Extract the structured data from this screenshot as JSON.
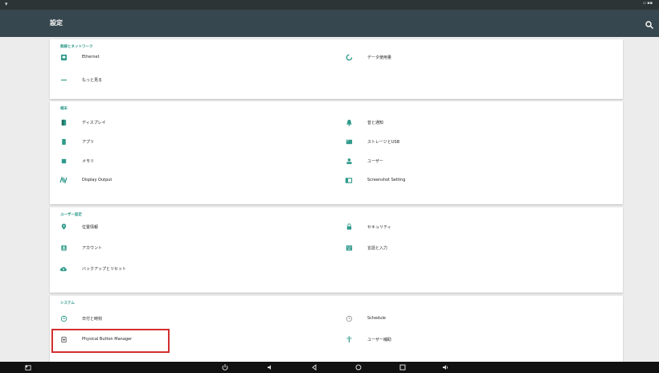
{
  "status": {
    "left": "▾",
    "right": "▫ ▪▪"
  },
  "appbar": {
    "title": "設定",
    "search_icon": "search-icon"
  },
  "sections": [
    {
      "title": "無線とネットワーク",
      "items": [
        {
          "label": "Ethernet",
          "icon": "ethernet-icon",
          "col": 0
        },
        {
          "label": "データ使用量",
          "icon": "data-usage-icon",
          "col": 1
        },
        {
          "label": "もっと見る",
          "icon": "more-icon",
          "col": 0
        }
      ]
    },
    {
      "title": "端末",
      "items": [
        {
          "label": "ディスプレイ",
          "icon": "display-icon",
          "col": 0
        },
        {
          "label": "音と通知",
          "icon": "sound-icon",
          "col": 1
        },
        {
          "label": "アプリ",
          "icon": "apps-icon",
          "col": 0
        },
        {
          "label": "ストレージとUSB",
          "icon": "storage-icon",
          "col": 1
        },
        {
          "label": "メモリ",
          "icon": "memory-icon",
          "col": 0
        },
        {
          "label": "ユーザー",
          "icon": "user-icon",
          "col": 1
        },
        {
          "label": "Display Output",
          "icon": "display-output-icon",
          "col": 0
        },
        {
          "label": "Screenshot Setting",
          "icon": "screenshot-icon",
          "col": 1
        }
      ]
    },
    {
      "title": "ユーザー設定",
      "items": [
        {
          "label": "位置情報",
          "icon": "location-icon",
          "col": 0
        },
        {
          "label": "セキュリティ",
          "icon": "lock-icon",
          "col": 1
        },
        {
          "label": "アカウント",
          "icon": "account-icon",
          "col": 0
        },
        {
          "label": "言語と入力",
          "icon": "keyboard-icon",
          "col": 1
        },
        {
          "label": "バックアップとリセット",
          "icon": "backup-icon",
          "col": 0
        }
      ]
    },
    {
      "title": "システム",
      "items": [
        {
          "label": "日付と時刻",
          "icon": "clock-icon",
          "col": 0
        },
        {
          "label": "Schedule",
          "icon": "schedule-icon",
          "col": 1
        },
        {
          "label": "Physical Button Manager",
          "icon": "button-manager-icon",
          "col": 0
        },
        {
          "label": "ユーザー補助",
          "icon": "accessibility-icon",
          "col": 1
        }
      ]
    }
  ],
  "navbar": [
    "screenshot-icon",
    "power-icon",
    "volume-icon",
    "back-icon",
    "home-icon",
    "recents-icon",
    "volume-up-icon"
  ],
  "colors": {
    "accent": "#2e9a8a",
    "appbar": "#37474f",
    "highlight": "#d32f2f"
  }
}
